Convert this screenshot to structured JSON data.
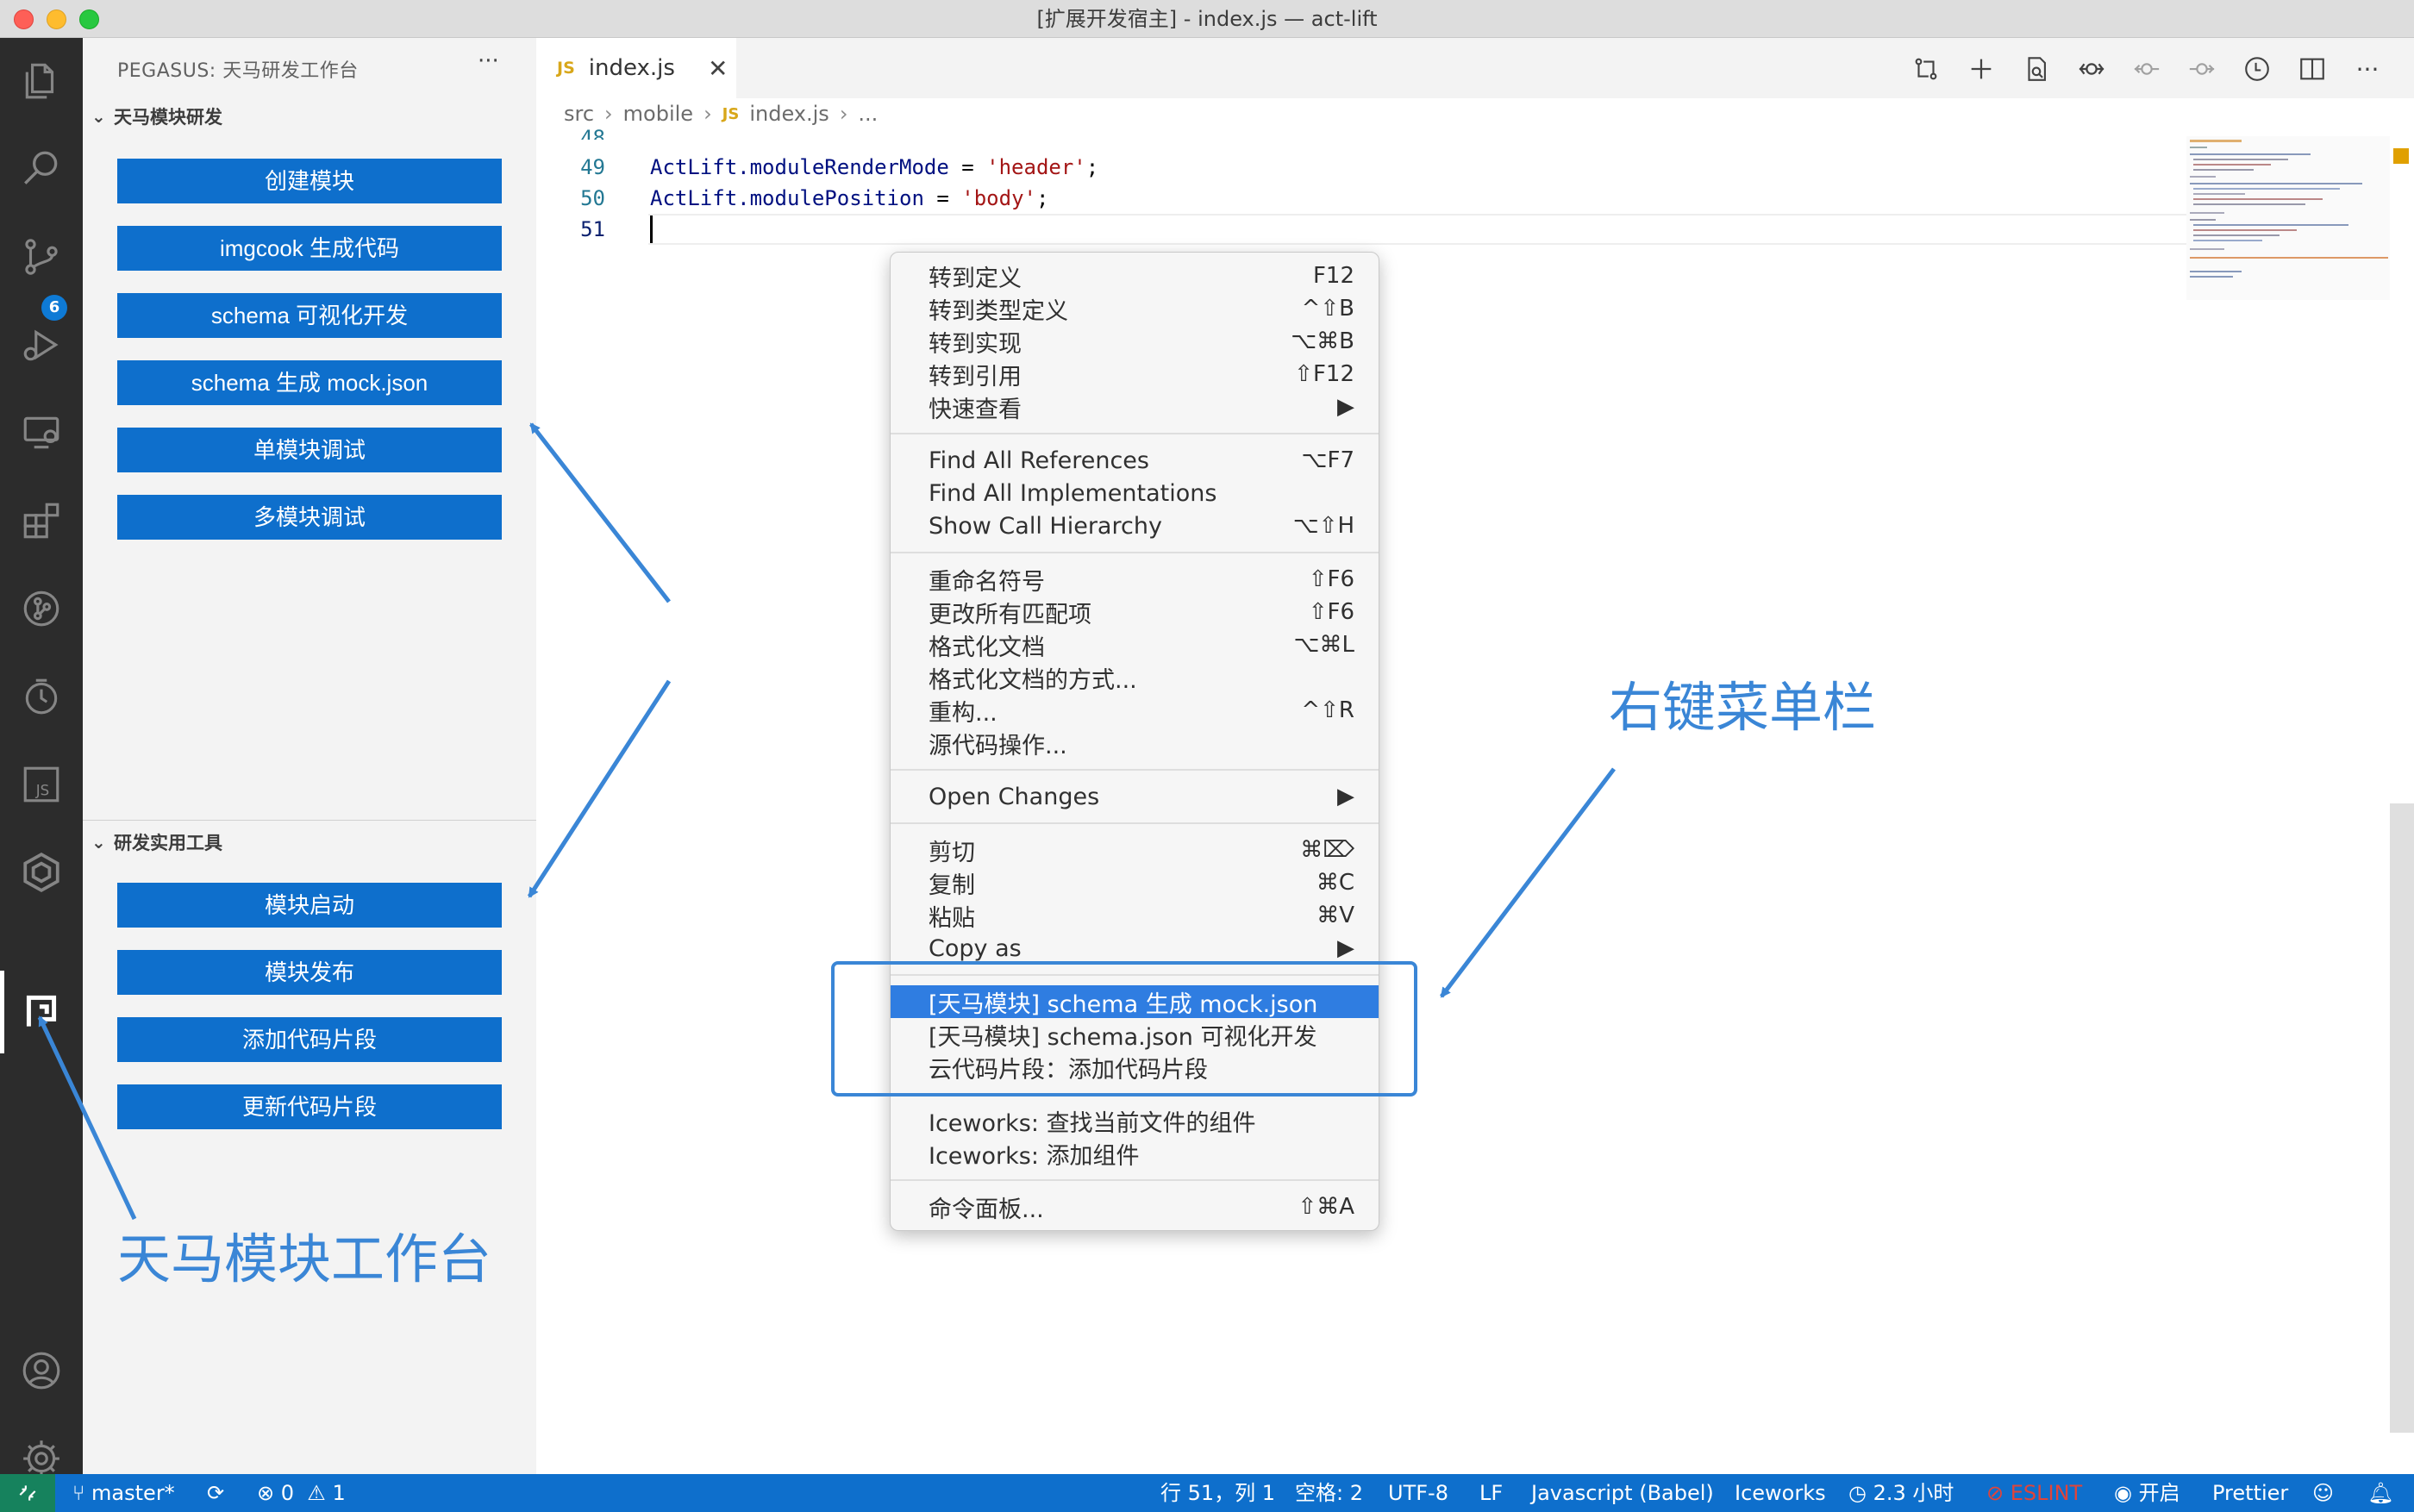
{
  "window": {
    "title": "[扩展开发宿主] - index.js — act-lift"
  },
  "sidebar": {
    "title": "PEGASUS: 天马研发工作台",
    "more": "···",
    "section1": {
      "title": "天马模块研发",
      "buttons": [
        "创建模块",
        "imgcook 生成代码",
        "schema 可视化开发",
        "schema 生成 mock.json",
        "单模块调试",
        "多模块调试"
      ]
    },
    "section2": {
      "title": "研发实用工具",
      "buttons": [
        "模块启动",
        "模块发布",
        "添加代码片段",
        "更新代码片段"
      ]
    }
  },
  "activitybar": {
    "scm_badge": "6"
  },
  "editor": {
    "tab": {
      "icon": "JS",
      "name": "index.js",
      "close": "✕"
    },
    "breadcrumb": [
      "src",
      "mobile",
      "index.js",
      "..."
    ],
    "breadcrumb_js_icon": "JS",
    "lines": [
      {
        "num": "49",
        "obj": "ActLift",
        "prop": ".moduleRenderMode",
        "op": " = ",
        "str": "'header'",
        "end": ";"
      },
      {
        "num": "50",
        "obj": "ActLift",
        "prop": ".modulePosition",
        "op": " = ",
        "str": "'body'",
        "end": ";"
      },
      {
        "num": "51",
        "obj": "",
        "prop": "",
        "op": "",
        "str": "",
        "end": ""
      }
    ],
    "partial_line_num": "48"
  },
  "context_menu": {
    "groups": [
      [
        {
          "label": "转到定义",
          "key": "F12"
        },
        {
          "label": "转到类型定义",
          "key": "^⇧B"
        },
        {
          "label": "转到实现",
          "key": "⌥⌘B"
        },
        {
          "label": "转到引用",
          "key": "⇧F12"
        },
        {
          "label": "快速查看",
          "key": "▶"
        }
      ],
      [
        {
          "label": "Find All References",
          "key": "⌥F7"
        },
        {
          "label": "Find All Implementations",
          "key": ""
        },
        {
          "label": "Show Call Hierarchy",
          "key": "⌥⇧H"
        }
      ],
      [
        {
          "label": "重命名符号",
          "key": "⇧F6"
        },
        {
          "label": "更改所有匹配项",
          "key": "⇧F6"
        },
        {
          "label": "格式化文档",
          "key": "⌥⌘L"
        },
        {
          "label": "格式化文档的方式...",
          "key": ""
        },
        {
          "label": "重构...",
          "key": "^⇧R"
        },
        {
          "label": "源代码操作...",
          "key": ""
        }
      ],
      [
        {
          "label": "Open Changes",
          "key": "▶"
        }
      ],
      [
        {
          "label": "剪切",
          "key": "⌘⌦"
        },
        {
          "label": "复制",
          "key": "⌘C"
        },
        {
          "label": "粘贴",
          "key": "⌘V"
        },
        {
          "label": "Copy as",
          "key": "▶"
        }
      ],
      [
        {
          "label": "[天马模块] schema 生成 mock.json",
          "key": "",
          "highlighted": true
        },
        {
          "label": "[天马模块] schema.json 可视化开发",
          "key": ""
        },
        {
          "label": "云代码片段：添加代码片段",
          "key": ""
        }
      ],
      [
        {
          "label": "Iceworks: 查找当前文件的组件",
          "key": ""
        },
        {
          "label": "Iceworks: 添加组件",
          "key": ""
        }
      ],
      [
        {
          "label": "命令面板...",
          "key": "⇧⌘A"
        }
      ]
    ]
  },
  "annotations": {
    "workbench": "天马模块工作台",
    "context_menu": "右键菜单栏",
    "color": "#3a86d6"
  },
  "statusbar": {
    "branch": "master*",
    "errors": "0",
    "warnings": "1",
    "position": "行 51，列 1",
    "spaces": "空格: 2",
    "encoding": "UTF-8",
    "eol": "LF",
    "language": "Javascript (Babel)",
    "iceworks": "Iceworks",
    "time": "2.3 小时",
    "eslint": "ESLINT",
    "golive": "开启",
    "prettier": "Prettier"
  },
  "colors": {
    "accent": "#0e6fcc",
    "activitybar": "#2c2c2c",
    "sidebar": "#f3f3f3",
    "menu_highlight": "#2f7de1",
    "eslint": "#e0443a"
  }
}
